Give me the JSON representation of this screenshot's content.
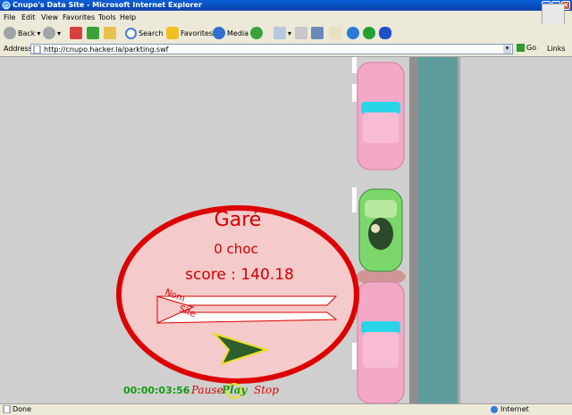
{
  "window": {
    "title": "Cnupo's Data Site - Microsoft Internet Explorer"
  },
  "menu": [
    "File",
    "Edit",
    "View",
    "Favorites",
    "Tools",
    "Help"
  ],
  "toolbar": {
    "back": "Back",
    "search": "Search",
    "favorites": "Favorites",
    "media": "Media"
  },
  "address": {
    "label": "Address",
    "url": "http://cnupo.hacker.la/parkting.swf",
    "go": "Go",
    "links": "Links"
  },
  "game": {
    "status": "Garé",
    "collisions": "0 choc",
    "score": "score : 140.18",
    "name_label": "Nom",
    "site_label": "Site",
    "timer": "00:00:03:56",
    "pause": "Pause",
    "play": "Play",
    "stop": "Stop"
  },
  "status": {
    "left": "Done",
    "right": "Internet"
  },
  "colors": {
    "red": "#dd0000",
    "pink_car": "#f4a8c8",
    "green_car": "#7cd66a",
    "water": "#5f9c9c",
    "timer": "#159a15"
  }
}
